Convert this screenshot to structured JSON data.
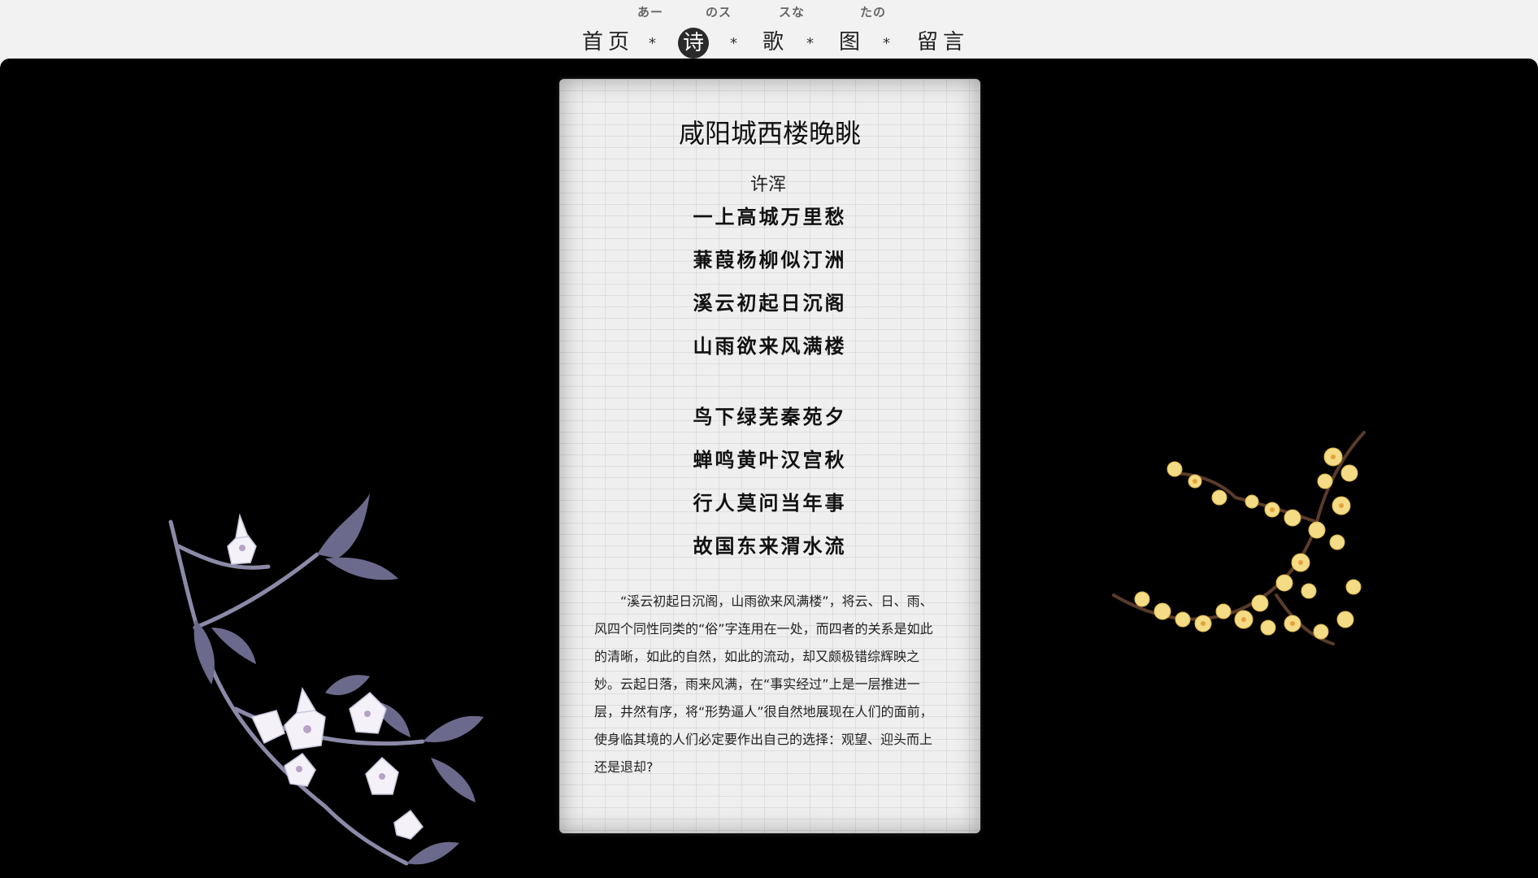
{
  "nav": {
    "romaji": [
      "あー",
      "のス",
      "スな",
      "たの"
    ],
    "items": [
      {
        "label": "首页",
        "active": false
      },
      {
        "label": "诗",
        "active": true
      },
      {
        "label": "歌",
        "active": false
      },
      {
        "label": "图",
        "active": false
      },
      {
        "label": "留言",
        "active": false
      }
    ],
    "separator": "*"
  },
  "poem": {
    "title": "咸阳城西楼晚眺",
    "author": "许浑",
    "stanza1": [
      "一上高城万里愁",
      "蒹葭杨柳似汀洲",
      "溪云初起日沉阁",
      "山雨欲来风满楼"
    ],
    "stanza2": [
      "鸟下绿芜秦苑夕",
      "蝉鸣黄叶汉宫秋",
      "行人莫问当年事",
      "故国东来渭水流"
    ],
    "commentary": "“溪云初起日沉阁，山雨欲来风满楼”，将云、日、雨、风四个同性同类的“俗”字连用在一处，而四者的关系是如此的清晰，如此的自然，如此的流动，却又颇极错综辉映之妙。云起日落，雨来风满，在“事实经过”上是一层推进一层，井然有序，将“形势逼人”很自然地展现在人们的面前，使身临其境的人们必定要作出自己的选择：观望、迎头而上还是退却?"
  },
  "decorations": {
    "left": "magnolia-branch",
    "right": "plum-blossom-branch"
  },
  "colors": {
    "stage": "#000000",
    "paper": "#efefef",
    "nav_active_bg": "#2a2a2a",
    "topbar": "#f2f2f2"
  }
}
